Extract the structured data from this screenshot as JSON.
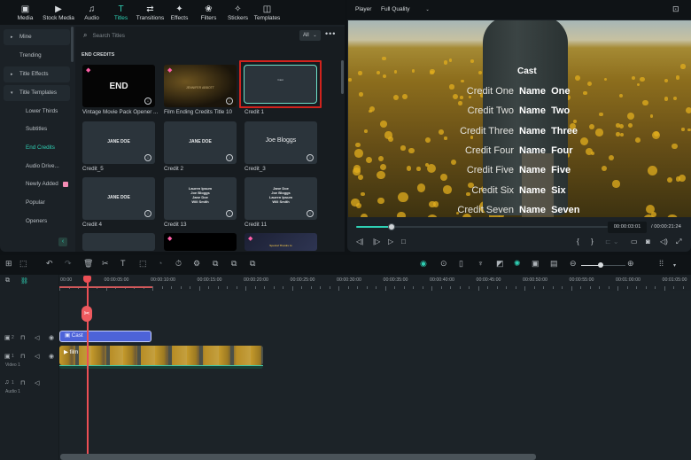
{
  "topnav": [
    {
      "label": "Media",
      "icon": "media-icon",
      "glyph": "▣"
    },
    {
      "label": "Stock Media",
      "icon": "stock-media-icon",
      "glyph": "▶"
    },
    {
      "label": "Audio",
      "icon": "audio-icon",
      "glyph": "♫"
    },
    {
      "label": "Titles",
      "icon": "titles-icon",
      "glyph": "T",
      "active": true
    },
    {
      "label": "Transitions",
      "icon": "transitions-icon",
      "glyph": "⇄"
    },
    {
      "label": "Effects",
      "icon": "effects-icon",
      "glyph": "✦"
    },
    {
      "label": "Filters",
      "icon": "filters-icon",
      "glyph": "❀"
    },
    {
      "label": "Stickers",
      "icon": "stickers-icon",
      "glyph": "✧"
    },
    {
      "label": "Templates",
      "icon": "templates-icon",
      "glyph": "◫"
    }
  ],
  "sidebar": {
    "items": [
      {
        "label": "Mine",
        "arrow": "▸"
      },
      {
        "label": "Trending"
      },
      {
        "label": "Title Effects",
        "arrow": "▸"
      },
      {
        "label": "Title Templates",
        "arrow": "▾"
      }
    ],
    "subitems": [
      {
        "label": "Lower Thirds"
      },
      {
        "label": "Subtitles"
      },
      {
        "label": "End Credits",
        "active": true
      },
      {
        "label": "Audio Drive..."
      },
      {
        "label": "Newly Added",
        "badge": true
      },
      {
        "label": "Popular"
      },
      {
        "label": "Openers"
      }
    ],
    "collapse_glyph": "‹"
  },
  "library": {
    "search_placeholder": "Search Titles",
    "filter_value": "All",
    "more_glyph": "•••",
    "section": "END CREDITS",
    "cards": [
      {
        "label": "Vintage Movie Pack Opener ...",
        "preview": "END",
        "premium": true
      },
      {
        "label": "Film Ending Credits Title 10",
        "preview": "JENNIFER ABBOTT",
        "premium": true
      },
      {
        "label": "Credit 1",
        "preview": "Cast",
        "selected": true
      },
      {
        "label": "Credit_5",
        "preview": "JANE DOE"
      },
      {
        "label": "Credit 2",
        "preview": "JANE DOE"
      },
      {
        "label": "Credit_3",
        "preview": "Joe Bloggs"
      },
      {
        "label": "Credit 4",
        "preview": "JANE DOE"
      },
      {
        "label": "Credit 13",
        "preview": "Lauren Ipsum\nJoe Bloggs\nJane Doe\nWill Smith"
      },
      {
        "label": "Credit 11",
        "preview": "Jane Doe\nJoe Bloggs\nLauren Ipsum\nWill Smith"
      }
    ],
    "partial_card_text": "Special Thanks to"
  },
  "player": {
    "label": "Player",
    "quality": "Full Quality",
    "cast_title": "Cast",
    "credits": [
      {
        "role": "Credit One",
        "name": "Name  One"
      },
      {
        "role": "Credit Two",
        "name": "Name  Two"
      },
      {
        "role": "Credit Three",
        "name": "Name  Three"
      },
      {
        "role": "Credit Four",
        "name": "Name  Four"
      },
      {
        "role": "Credit Five",
        "name": "Name  Five"
      },
      {
        "role": "Credit Six",
        "name": "Name  Six"
      },
      {
        "role": "Credit Seven",
        "name": "Name  Seven"
      }
    ],
    "current_time": "00:00:03:01",
    "total_time": "/  00:00:21:24",
    "progress": 0.14
  },
  "timeline": {
    "ruler": [
      "00:00",
      "00:00:05:00",
      "00:00:10:00",
      "00:00:15:00",
      "00:00:20:00",
      "00:00:25:00",
      "00:00:30:00",
      "00:00:35:00",
      "00:00:40:00",
      "00:00:45:00",
      "00:00:50:00",
      "00:00:55:00",
      "00:01:00:00",
      "00:01:05:00"
    ],
    "tracks": [
      {
        "num": "2",
        "label": ""
      },
      {
        "num": "1",
        "label": "Video 1"
      },
      {
        "num": "1",
        "label": "Audio 1"
      }
    ],
    "clips": {
      "title": "Cast",
      "video": "film"
    },
    "zoom_level": 0.45
  }
}
